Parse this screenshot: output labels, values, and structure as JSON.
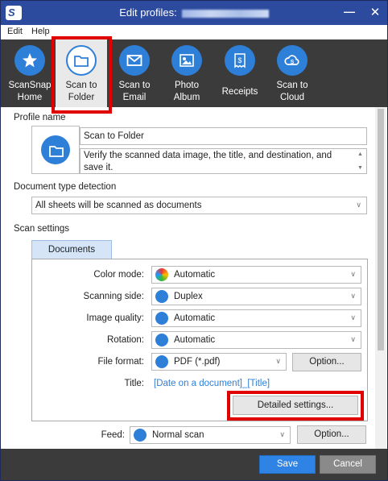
{
  "window": {
    "title": "Edit profiles:"
  },
  "menu": [
    "Edit",
    "Help"
  ],
  "toolbar": {
    "items": [
      {
        "line1": "ScanSnap",
        "line2": "Home",
        "icon": "star-icon"
      },
      {
        "line1": "Scan to",
        "line2": "Folder",
        "icon": "folder-icon"
      },
      {
        "line1": "Scan to",
        "line2": "Email",
        "icon": "envelope-icon"
      },
      {
        "line1": "Photo",
        "line2": "Album",
        "icon": "photo-album-icon"
      },
      {
        "line1": "Receipts",
        "line2": "",
        "icon": "receipt-icon"
      },
      {
        "line1": "Scan to",
        "line2": "Cloud",
        "icon": "cloud-icon"
      }
    ]
  },
  "profile": {
    "section_label": "Profile name",
    "name": "Scan to Folder",
    "description": "Verify the scanned data image, the title, and destination, and save it."
  },
  "document_type": {
    "label": "Document type detection",
    "value": "All sheets will be scanned as documents"
  },
  "scan_settings": {
    "label": "Scan settings",
    "tab": "Documents",
    "color_mode_label": "Color mode:",
    "color_mode_value": "Automatic",
    "scanning_side_label": "Scanning side:",
    "scanning_side_value": "Duplex",
    "image_quality_label": "Image quality:",
    "image_quality_value": "Automatic",
    "rotation_label": "Rotation:",
    "rotation_value": "Automatic",
    "file_format_label": "File format:",
    "file_format_value": "PDF (*.pdf)",
    "option_button": "Option...",
    "title_label": "Title:",
    "title_value": "[Date on a document]_[Title]",
    "detailed_settings_button": "Detailed settings..."
  },
  "feed": {
    "label": "Feed:",
    "value": "Normal scan",
    "option_button": "Option..."
  },
  "footer": {
    "save": "Save",
    "cancel": "Cancel"
  },
  "colors": {
    "titlebar": "#2c4a9e",
    "accent": "#2e7fd8",
    "highlight": "#e00000",
    "toolbar": "#3b3b3b"
  }
}
